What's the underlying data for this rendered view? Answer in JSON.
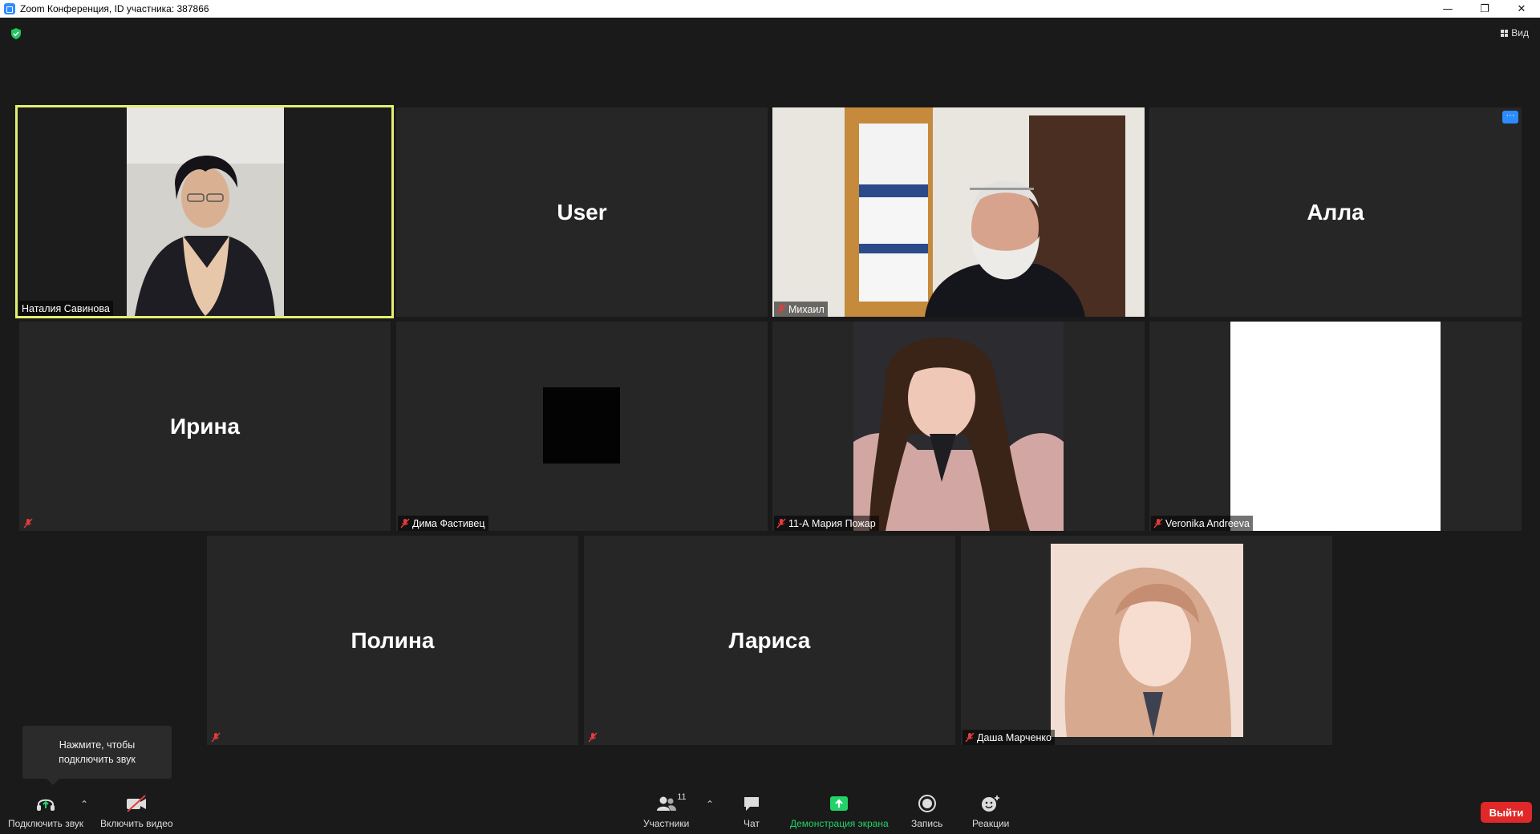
{
  "window": {
    "title": "Zoom Конференция, ID участника: 387866"
  },
  "top": {
    "view_label": "Вид"
  },
  "participants": [
    {
      "name": "Наталия Савинова",
      "big_name": "",
      "muted": false,
      "speaking": true,
      "video": "woman-dark-hair"
    },
    {
      "name": "",
      "big_name": "User",
      "muted": false,
      "video": ""
    },
    {
      "name": "Михаил",
      "big_name": "",
      "muted": true,
      "video": "man-white-beard"
    },
    {
      "name": "",
      "big_name": "Алла",
      "muted": false,
      "video": ""
    },
    {
      "name": "",
      "big_name": "Ирина",
      "muted": true,
      "video": ""
    },
    {
      "name": "Дима Фастивец",
      "big_name": "",
      "muted": true,
      "video": "black-square"
    },
    {
      "name": "11-А Мария Пожар",
      "big_name": "",
      "muted": true,
      "video": "girl-curly-hair"
    },
    {
      "name": "Veronika Andreeva",
      "big_name": "",
      "muted": true,
      "video": "white-frame"
    },
    {
      "name": "",
      "big_name": "Полина",
      "muted": true,
      "video": ""
    },
    {
      "name": "",
      "big_name": "Лариса",
      "muted": true,
      "video": ""
    },
    {
      "name": "Даша Марченко",
      "big_name": "",
      "muted": true,
      "video": "girl-blonde-hair"
    }
  ],
  "tooltip": {
    "line1": "Нажмите, чтобы",
    "line2": "подключить звук"
  },
  "toolbar": {
    "audio": "Подключить звук",
    "video": "Включить видео",
    "participants": "Участники",
    "participants_count": "11",
    "chat": "Чат",
    "share": "Демонстрация экрана",
    "record": "Запись",
    "reactions": "Реакции",
    "leave": "Выйти"
  },
  "colors": {
    "accent": "#2d8cff",
    "active_border": "#e3ef6f",
    "share_green": "#22d36a",
    "leave_red": "#e02828",
    "mute_red": "#e23c3c"
  }
}
